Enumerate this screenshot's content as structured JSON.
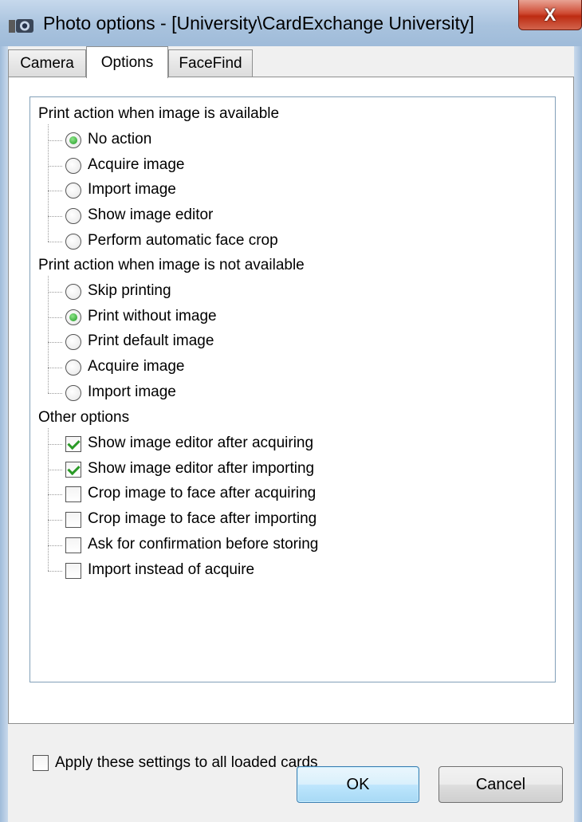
{
  "window": {
    "title": "Photo options - [University\\CardExchange University]",
    "close_glyph": "X"
  },
  "tabs": [
    {
      "label": "Camera",
      "active": false
    },
    {
      "label": "Options",
      "active": true
    },
    {
      "label": "FaceFind",
      "active": false
    }
  ],
  "groups": {
    "available": {
      "label": "Print action when image is available",
      "options": [
        {
          "label": "No action",
          "checked": true
        },
        {
          "label": "Acquire image",
          "checked": false
        },
        {
          "label": "Import image",
          "checked": false
        },
        {
          "label": "Show image editor",
          "checked": false
        },
        {
          "label": "Perform automatic face crop",
          "checked": false
        }
      ]
    },
    "not_available": {
      "label": "Print action when image is not available",
      "options": [
        {
          "label": "Skip printing",
          "checked": false
        },
        {
          "label": "Print without image",
          "checked": true
        },
        {
          "label": "Print default image",
          "checked": false
        },
        {
          "label": "Acquire image",
          "checked": false
        },
        {
          "label": "Import image",
          "checked": false
        }
      ]
    },
    "other": {
      "label": "Other options",
      "options": [
        {
          "label": "Show image editor after acquiring",
          "checked": true
        },
        {
          "label": "Show image editor after importing",
          "checked": true
        },
        {
          "label": "Crop image to face after acquiring",
          "checked": false
        },
        {
          "label": "Crop image to face after importing",
          "checked": false
        },
        {
          "label": "Ask for confirmation before storing",
          "checked": false
        },
        {
          "label": "Import instead of acquire",
          "checked": false
        }
      ]
    }
  },
  "footer": {
    "apply_all_label": "Apply these settings to all loaded cards",
    "apply_all_checked": false,
    "ok_label": "OK",
    "cancel_label": "Cancel"
  },
  "colors": {
    "radio_dot": "#1e9a23",
    "checkmark": "#2a9a26",
    "ok_border": "#3c7fb1"
  },
  "icons": {
    "app": "camera-icon",
    "close": "close-icon"
  }
}
